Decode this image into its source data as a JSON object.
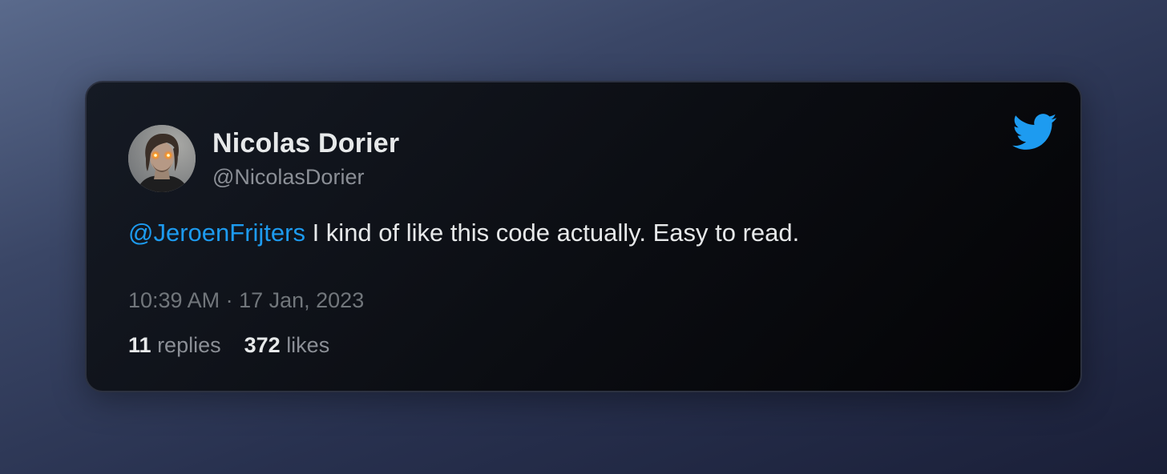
{
  "tweet": {
    "author_name": "Nicolas Dorier",
    "author_handle": "@NicolasDorier",
    "mention": "@JeroenFrijters",
    "text": " I kind of like this code actually. Easy to read.",
    "timestamp": "10:39 AM · 17 Jan, 2023",
    "replies_count": "11",
    "replies_label": "replies",
    "likes_count": "372",
    "likes_label": "likes"
  },
  "icons": {
    "brand": "twitter-bird-icon",
    "avatar": "avatar-photo"
  },
  "colors": {
    "accent": "#1d9bf0",
    "card_background": "#0b0d12",
    "primary_text": "#e7e9ea",
    "secondary_text": "#8b8f96"
  }
}
